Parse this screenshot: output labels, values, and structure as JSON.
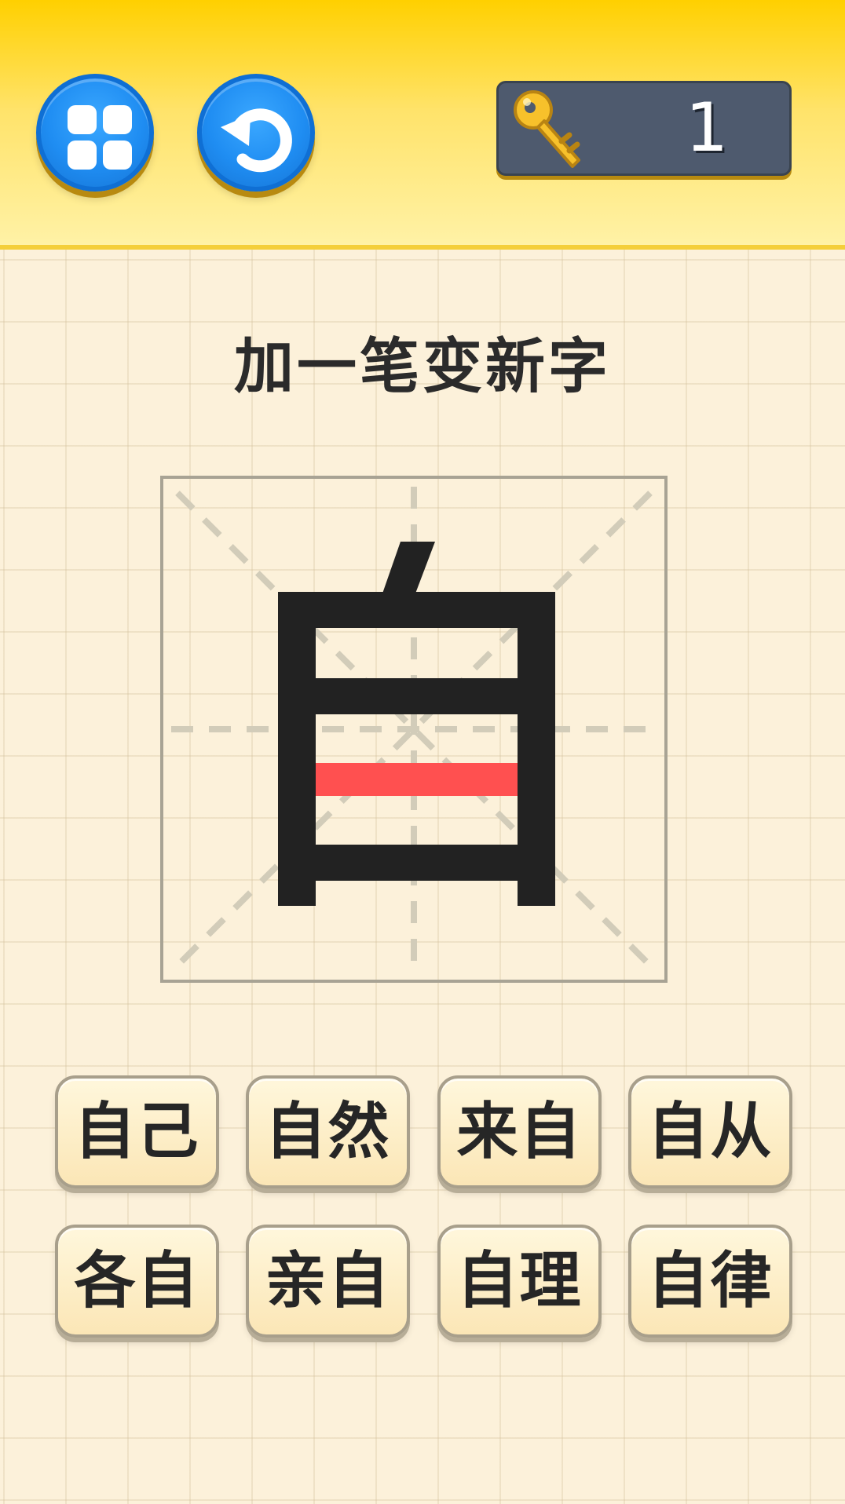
{
  "header": {
    "menu_icon": "grid-icon",
    "restart_icon": "restart-icon",
    "key_icon": "key-icon",
    "key_count": "1"
  },
  "puzzle": {
    "title": "加一笔变新字",
    "added_stroke_color": "#ff5050",
    "character_color": "#222222"
  },
  "answers": [
    "自己",
    "自然",
    "来自",
    "自从",
    "各自",
    "亲自",
    "自理",
    "自律"
  ],
  "colors": {
    "header_yellow": "#ffd000",
    "button_blue": "#1f8df2",
    "panel_slate": "#4e5a6e",
    "paper": "#fcf1da"
  }
}
